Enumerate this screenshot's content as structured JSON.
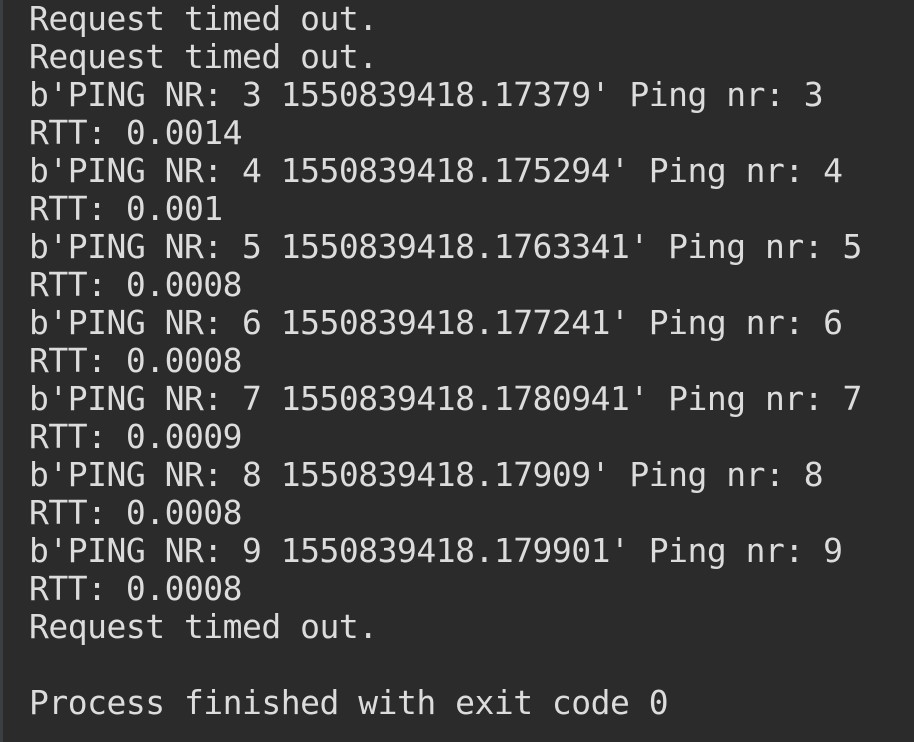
{
  "console": {
    "lines": [
      "Request timed out.",
      "Request timed out.",
      "b'PING NR: 3 1550839418.17379' Ping nr: 3",
      "RTT: 0.0014",
      "b'PING NR: 4 1550839418.175294' Ping nr: 4",
      "RTT: 0.001",
      "b'PING NR: 5 1550839418.1763341' Ping nr: 5",
      "RTT: 0.0008",
      "b'PING NR: 6 1550839418.177241' Ping nr: 6",
      "RTT: 0.0008",
      "b'PING NR: 7 1550839418.1780941' Ping nr: 7",
      "RTT: 0.0009",
      "b'PING NR: 8 1550839418.17909' Ping nr: 8",
      "RTT: 0.0008",
      "b'PING NR: 9 1550839418.179901' Ping nr: 9",
      "RTT: 0.0008",
      "Request timed out."
    ],
    "exit_message": "Process finished with exit code 0"
  },
  "colors": {
    "background": "#2b2b2b",
    "text": "#dcdcdc"
  }
}
